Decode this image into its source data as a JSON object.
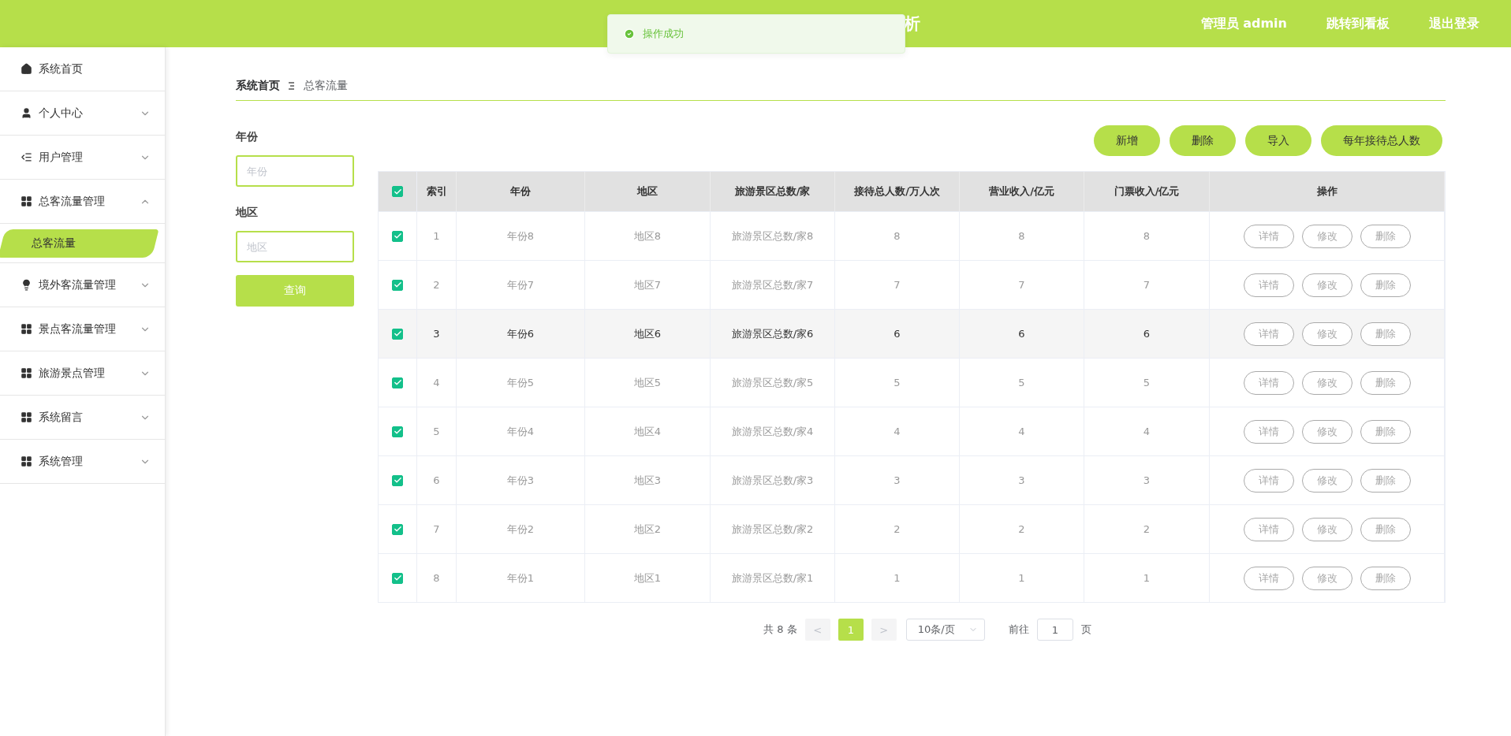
{
  "header": {
    "title": "析",
    "links": [
      "管理员 admin",
      "跳转到看板",
      "退出登录"
    ]
  },
  "toast": {
    "message": "操作成功"
  },
  "sidebar": {
    "items": [
      {
        "label": "系统首页"
      },
      {
        "label": "个人中心",
        "expanded": false
      },
      {
        "label": "用户管理",
        "expanded": false
      },
      {
        "label": "总客流量管理",
        "expanded": true,
        "children": [
          {
            "label": "总客流量",
            "selected": true
          }
        ]
      },
      {
        "label": "境外客流量管理",
        "expanded": false
      },
      {
        "label": "景点客流量管理",
        "expanded": false
      },
      {
        "label": "旅游景点管理",
        "expanded": false
      },
      {
        "label": "系统留言",
        "expanded": false
      },
      {
        "label": "系统管理",
        "expanded": false
      }
    ]
  },
  "breadcrumb": [
    "系统首页",
    "总客流量"
  ],
  "filters": [
    {
      "label": "年份",
      "placeholder": "年份"
    },
    {
      "label": "地区",
      "placeholder": "地区"
    }
  ],
  "search_button": "查询",
  "actions": [
    "新增",
    "删除",
    "导入",
    "每年接待总人数"
  ],
  "table": {
    "all_checked": true,
    "columns": [
      "索引",
      "年份",
      "地区",
      "旅游景区总数/家",
      "接待总人数/万人次",
      "营业收入/亿元",
      "门票收入/亿元",
      "操作"
    ],
    "rows": [
      {
        "checked": true,
        "highlighted": false,
        "cells": [
          "1",
          "年份8",
          "地区8",
          "旅游景区总数/家8",
          "8",
          "8",
          "8"
        ],
        "actions": [
          "详情",
          "修改",
          "删除"
        ]
      },
      {
        "checked": true,
        "highlighted": false,
        "cells": [
          "2",
          "年份7",
          "地区7",
          "旅游景区总数/家7",
          "7",
          "7",
          "7"
        ],
        "actions": [
          "详情",
          "修改",
          "删除"
        ]
      },
      {
        "checked": true,
        "highlighted": true,
        "cells": [
          "3",
          "年份6",
          "地区6",
          "旅游景区总数/家6",
          "6",
          "6",
          "6"
        ],
        "actions": [
          "详情",
          "修改",
          "删除"
        ]
      },
      {
        "checked": true,
        "highlighted": false,
        "cells": [
          "4",
          "年份5",
          "地区5",
          "旅游景区总数/家5",
          "5",
          "5",
          "5"
        ],
        "actions": [
          "详情",
          "修改",
          "删除"
        ]
      },
      {
        "checked": true,
        "highlighted": false,
        "cells": [
          "5",
          "年份4",
          "地区4",
          "旅游景区总数/家4",
          "4",
          "4",
          "4"
        ],
        "actions": [
          "详情",
          "修改",
          "删除"
        ]
      },
      {
        "checked": true,
        "highlighted": false,
        "cells": [
          "6",
          "年份3",
          "地区3",
          "旅游景区总数/家3",
          "3",
          "3",
          "3"
        ],
        "actions": [
          "详情",
          "修改",
          "删除"
        ]
      },
      {
        "checked": true,
        "highlighted": false,
        "cells": [
          "7",
          "年份2",
          "地区2",
          "旅游景区总数/家2",
          "2",
          "2",
          "2"
        ],
        "actions": [
          "详情",
          "修改",
          "删除"
        ]
      },
      {
        "checked": true,
        "highlighted": false,
        "cells": [
          "8",
          "年份1",
          "地区1",
          "旅游景区总数/家1",
          "1",
          "1",
          "1"
        ],
        "actions": [
          "详情",
          "修改",
          "删除"
        ]
      }
    ]
  },
  "pagination": {
    "total": "共 8 条",
    "prev": "<",
    "pages": [
      {
        "label": "1",
        "selected": true
      }
    ],
    "next": ">",
    "page_size": "10条/页",
    "goto_label": "前往",
    "goto_value": "1",
    "goto_suffix": "页"
  }
}
